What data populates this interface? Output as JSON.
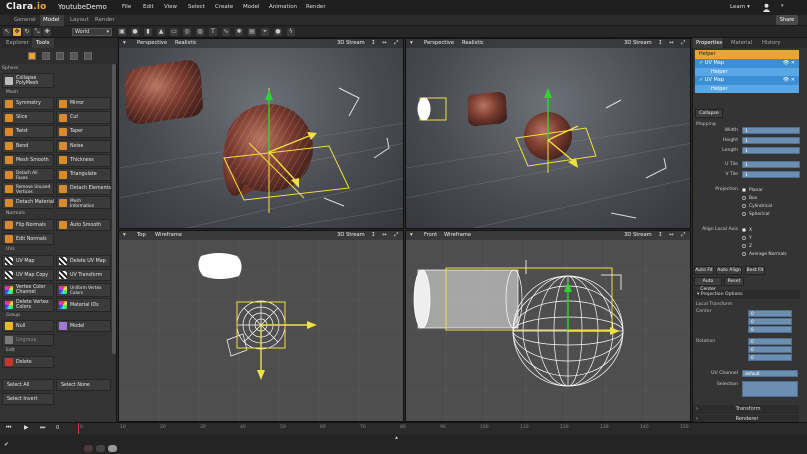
{
  "app": {
    "logo_main": "Clara",
    "logo_suffix": ".io",
    "project": "YoutubeDemo"
  },
  "menu": [
    "File",
    "Edit",
    "View",
    "Select",
    "Create",
    "Model",
    "Animation",
    "Render"
  ],
  "top_right": {
    "learn": "Learn ▾",
    "share": "Share"
  },
  "mode_tabs": [
    "General",
    "Model",
    "Layout",
    "Render"
  ],
  "mode_selected": "Model",
  "world_select": "World",
  "left_tabs": [
    "Explorer",
    "Tools"
  ],
  "left_tab_selected": "Tools",
  "tools": {
    "sphere": "Sphere",
    "collapse": "Collapse\nPolyMesh",
    "mesh_label": "Mesh",
    "mesh": [
      [
        "Symmetry",
        "Mirror"
      ],
      [
        "Slice",
        "Cut"
      ],
      [
        "Twist",
        "Taper"
      ],
      [
        "Bend",
        "Noise"
      ],
      [
        "Mesh Smooth",
        "Thickness"
      ],
      [
        "Detach All\nFaces",
        "Triangulate"
      ],
      [
        "Remove Unused\nVertices",
        "Detach Elements"
      ],
      [
        "Detach Material IDs",
        "Mesh\nInformation"
      ]
    ],
    "normals_label": "Normals",
    "normals": [
      [
        "Flip Normals",
        "Auto Smooth"
      ],
      [
        "Edit Normals",
        ""
      ]
    ],
    "uvs_label": "UVs",
    "uvs": [
      [
        "UV Map",
        "Delete UV Map"
      ],
      [
        "UV Map Copy",
        "UV Transform"
      ],
      [
        "Vertex Color\nChannel",
        "Uniform Vertex\nColors"
      ],
      [
        "Delete Vertex\nColors",
        "Material IDs"
      ]
    ],
    "group_label": "Group",
    "group": [
      [
        "Null",
        "Model"
      ],
      [
        "Ungroup",
        ""
      ]
    ],
    "edit_label": "Edit",
    "edit": [
      "Delete"
    ],
    "select": [
      [
        "Select All",
        "Select None"
      ],
      [
        "Select Invert",
        ""
      ]
    ]
  },
  "viewports": [
    {
      "view": "Perspective",
      "shading": "Realistic",
      "stream": "3D Stream"
    },
    {
      "view": "Perspective",
      "shading": "Realistic",
      "stream": "3D Stream"
    },
    {
      "view": "Top",
      "shading": "Wireframe",
      "stream": "3D Stream"
    },
    {
      "view": "Front",
      "shading": "Wireframe",
      "stream": "3D Stream"
    }
  ],
  "right_tabs": [
    "Properties",
    "Material",
    "History"
  ],
  "right_tab_selected": "Properties",
  "stack": [
    {
      "label": "Helper",
      "kind": "parent"
    },
    {
      "label": "UV Map",
      "kind": "parent"
    },
    {
      "label": "Helper",
      "kind": "child"
    },
    {
      "label": "UV Map",
      "kind": "parent"
    },
    {
      "label": "Helper",
      "kind": "child"
    }
  ],
  "props": {
    "collapse": "Collapse",
    "mapping": "Mapping",
    "width": {
      "label": "Width",
      "value": "1"
    },
    "height": {
      "label": "Height",
      "value": "1"
    },
    "length": {
      "label": "Length",
      "value": "1"
    },
    "utile": {
      "label": "U Tile",
      "value": "1"
    },
    "vtile": {
      "label": "V Tile",
      "value": "1"
    },
    "projection_label": "Projection",
    "projection": [
      "Planar",
      "Box",
      "Cylindrical",
      "Spherical"
    ],
    "projection_selected": "Planar",
    "align_label": "Align Local Axis",
    "align": [
      "X",
      "Y",
      "Z",
      "Average Normals"
    ],
    "align_selected": "X",
    "buttons1": [
      "Auto Fit",
      "Auto Align",
      "Best Fit"
    ],
    "buttons2": [
      "Auto Center",
      "Reset"
    ],
    "projection_options": "Projection Options",
    "local_transform": "Local Transform",
    "center": "Center",
    "rotation": "Rotation",
    "center_values": [
      "0",
      "0",
      "0"
    ],
    "rotation_values": [
      "0",
      "0",
      "0"
    ],
    "uv_channel": {
      "label": "UV Channel",
      "value": "default"
    },
    "selection": "Selection",
    "transform": "Transform",
    "renderer": "Renderer"
  },
  "timeline": {
    "frame": "0",
    "ticks": [
      "0",
      "10",
      "20",
      "30",
      "40",
      "50",
      "60",
      "70",
      "80",
      "90",
      "100",
      "110",
      "120",
      "130",
      "140",
      "150"
    ]
  }
}
